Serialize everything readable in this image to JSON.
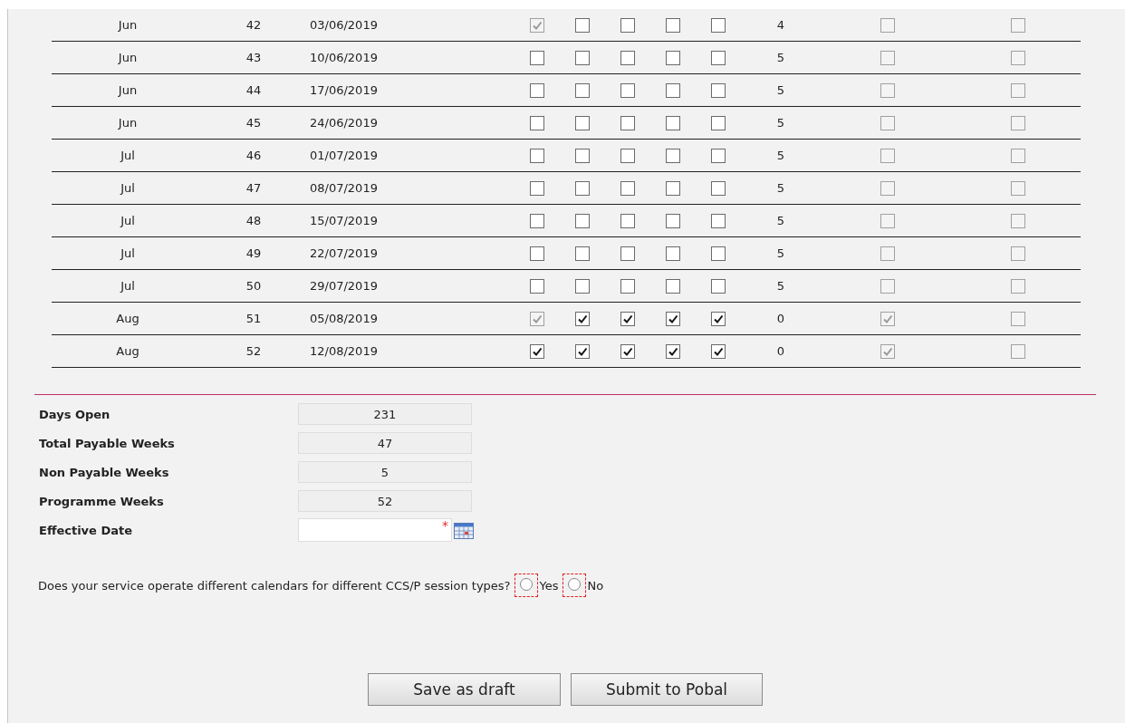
{
  "table": {
    "rows": [
      {
        "month": "Jun",
        "week": "42",
        "date": "03/06/2019",
        "days": [
          {
            "checked": true,
            "disabled": true
          },
          {
            "checked": false,
            "disabled": false
          },
          {
            "checked": false,
            "disabled": false
          },
          {
            "checked": false,
            "disabled": false
          },
          {
            "checked": false,
            "disabled": false
          }
        ],
        "count": "4",
        "column_7": {
          "checked": false,
          "disabled": true
        },
        "column_8": {
          "checked": false,
          "disabled": true
        }
      },
      {
        "month": "Jun",
        "week": "43",
        "date": "10/06/2019",
        "days": [
          {
            "checked": false,
            "disabled": false
          },
          {
            "checked": false,
            "disabled": false
          },
          {
            "checked": false,
            "disabled": false
          },
          {
            "checked": false,
            "disabled": false
          },
          {
            "checked": false,
            "disabled": false
          }
        ],
        "count": "5",
        "column_7": {
          "checked": false,
          "disabled": true
        },
        "column_8": {
          "checked": false,
          "disabled": true
        }
      },
      {
        "month": "Jun",
        "week": "44",
        "date": "17/06/2019",
        "days": [
          {
            "checked": false,
            "disabled": false
          },
          {
            "checked": false,
            "disabled": false
          },
          {
            "checked": false,
            "disabled": false
          },
          {
            "checked": false,
            "disabled": false
          },
          {
            "checked": false,
            "disabled": false
          }
        ],
        "count": "5",
        "column_7": {
          "checked": false,
          "disabled": true
        },
        "column_8": {
          "checked": false,
          "disabled": true
        }
      },
      {
        "month": "Jun",
        "week": "45",
        "date": "24/06/2019",
        "days": [
          {
            "checked": false,
            "disabled": false
          },
          {
            "checked": false,
            "disabled": false
          },
          {
            "checked": false,
            "disabled": false
          },
          {
            "checked": false,
            "disabled": false
          },
          {
            "checked": false,
            "disabled": false
          }
        ],
        "count": "5",
        "column_7": {
          "checked": false,
          "disabled": true
        },
        "column_8": {
          "checked": false,
          "disabled": true
        }
      },
      {
        "month": "Jul",
        "week": "46",
        "date": "01/07/2019",
        "days": [
          {
            "checked": false,
            "disabled": false
          },
          {
            "checked": false,
            "disabled": false
          },
          {
            "checked": false,
            "disabled": false
          },
          {
            "checked": false,
            "disabled": false
          },
          {
            "checked": false,
            "disabled": false
          }
        ],
        "count": "5",
        "column_7": {
          "checked": false,
          "disabled": true
        },
        "column_8": {
          "checked": false,
          "disabled": true
        }
      },
      {
        "month": "Jul",
        "week": "47",
        "date": "08/07/2019",
        "days": [
          {
            "checked": false,
            "disabled": false
          },
          {
            "checked": false,
            "disabled": false
          },
          {
            "checked": false,
            "disabled": false
          },
          {
            "checked": false,
            "disabled": false
          },
          {
            "checked": false,
            "disabled": false
          }
        ],
        "count": "5",
        "column_7": {
          "checked": false,
          "disabled": true
        },
        "column_8": {
          "checked": false,
          "disabled": true
        }
      },
      {
        "month": "Jul",
        "week": "48",
        "date": "15/07/2019",
        "days": [
          {
            "checked": false,
            "disabled": false
          },
          {
            "checked": false,
            "disabled": false
          },
          {
            "checked": false,
            "disabled": false
          },
          {
            "checked": false,
            "disabled": false
          },
          {
            "checked": false,
            "disabled": false
          }
        ],
        "count": "5",
        "column_7": {
          "checked": false,
          "disabled": true
        },
        "column_8": {
          "checked": false,
          "disabled": true
        }
      },
      {
        "month": "Jul",
        "week": "49",
        "date": "22/07/2019",
        "days": [
          {
            "checked": false,
            "disabled": false
          },
          {
            "checked": false,
            "disabled": false
          },
          {
            "checked": false,
            "disabled": false
          },
          {
            "checked": false,
            "disabled": false
          },
          {
            "checked": false,
            "disabled": false
          }
        ],
        "count": "5",
        "column_7": {
          "checked": false,
          "disabled": true
        },
        "column_8": {
          "checked": false,
          "disabled": true
        }
      },
      {
        "month": "Jul",
        "week": "50",
        "date": "29/07/2019",
        "days": [
          {
            "checked": false,
            "disabled": false
          },
          {
            "checked": false,
            "disabled": false
          },
          {
            "checked": false,
            "disabled": false
          },
          {
            "checked": false,
            "disabled": false
          },
          {
            "checked": false,
            "disabled": false
          }
        ],
        "count": "5",
        "column_7": {
          "checked": false,
          "disabled": true
        },
        "column_8": {
          "checked": false,
          "disabled": true
        }
      },
      {
        "month": "Aug",
        "week": "51",
        "date": "05/08/2019",
        "days": [
          {
            "checked": true,
            "disabled": true
          },
          {
            "checked": true,
            "disabled": false
          },
          {
            "checked": true,
            "disabled": false
          },
          {
            "checked": true,
            "disabled": false
          },
          {
            "checked": true,
            "disabled": false
          }
        ],
        "count": "0",
        "column_7": {
          "checked": true,
          "disabled": true
        },
        "column_8": {
          "checked": false,
          "disabled": true
        }
      },
      {
        "month": "Aug",
        "week": "52",
        "date": "12/08/2019",
        "days": [
          {
            "checked": true,
            "disabled": false
          },
          {
            "checked": true,
            "disabled": false
          },
          {
            "checked": true,
            "disabled": false
          },
          {
            "checked": true,
            "disabled": false
          },
          {
            "checked": true,
            "disabled": false
          }
        ],
        "count": "0",
        "column_7": {
          "checked": true,
          "disabled": true
        },
        "column_8": {
          "checked": false,
          "disabled": true
        }
      }
    ]
  },
  "summary": [
    {
      "label": "Days Open",
      "value": "231",
      "kind": "readonly"
    },
    {
      "label": "Total Payable Weeks",
      "value": "47",
      "kind": "readonly"
    },
    {
      "label": "Non Payable Weeks",
      "value": "5",
      "kind": "readonly"
    },
    {
      "label": "Programme Weeks",
      "value": "52",
      "kind": "readonly"
    },
    {
      "label": "Effective Date",
      "kind": "date",
      "required_mark": "*"
    }
  ],
  "question": {
    "text": "Does your service operate different calendars for different CCS/P session types?",
    "options": [
      {
        "label": "Yes",
        "selected": false,
        "invalid": true
      },
      {
        "label": "No",
        "selected": false,
        "invalid": true
      }
    ]
  },
  "buttons": [
    "Save as draft",
    "Submit to Pobal"
  ]
}
